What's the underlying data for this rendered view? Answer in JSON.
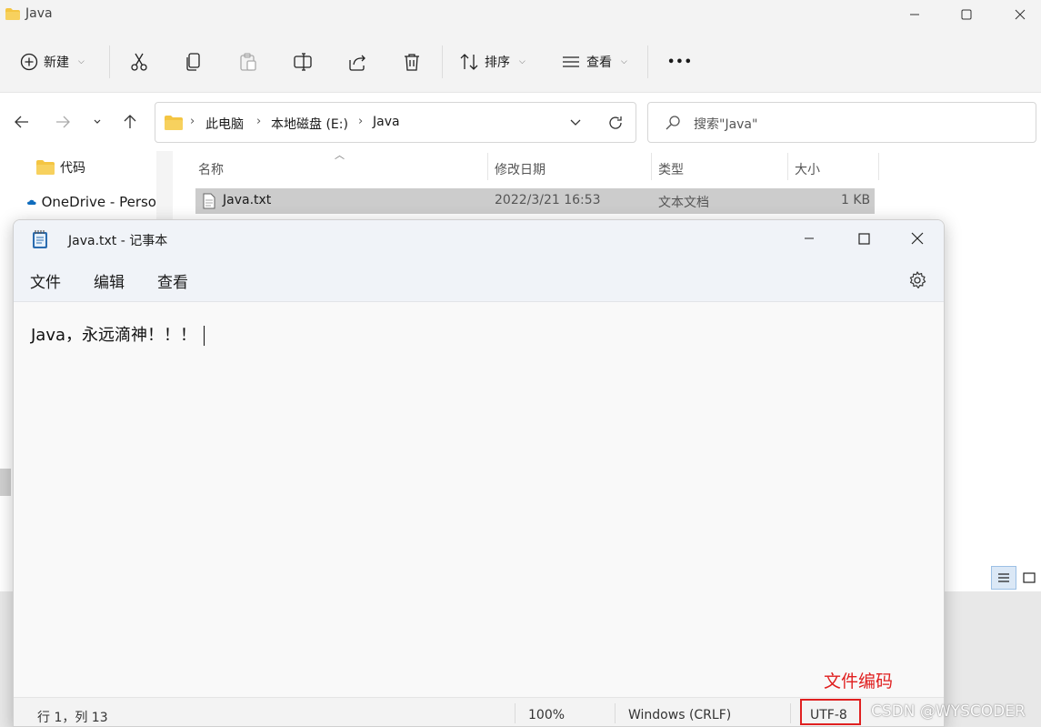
{
  "explorer": {
    "title": "Java",
    "toolbar": {
      "new_label": "新建",
      "sort_label": "排序",
      "view_label": "查看",
      "more_label": "•••"
    },
    "breadcrumb": [
      "此电脑",
      "本地磁盘 (E:)",
      "Java"
    ],
    "search_placeholder": "搜索\"Java\"",
    "nav_items": [
      {
        "label": "代码",
        "icon": "folder-icon"
      },
      {
        "label": "OneDrive - Perso",
        "icon": "onedrive-cloud-icon"
      }
    ],
    "columns": {
      "name": "名称",
      "modified": "修改日期",
      "type": "类型",
      "size": "大小"
    },
    "files": [
      {
        "name": "Java.txt",
        "modified": "2022/3/21 16:53",
        "type": "文本文档",
        "size": "1 KB"
      }
    ]
  },
  "notepad": {
    "title": "Java.txt - 记事本",
    "menus": [
      "文件",
      "编辑",
      "查看"
    ],
    "content": "Java，永远滴神！！！",
    "status": {
      "position": "行 1，列 13",
      "zoom": "100%",
      "line_ending": "Windows (CRLF)",
      "encoding": "UTF-8"
    }
  },
  "annotation": {
    "label": "文件编码",
    "color": "#e02020"
  },
  "watermark": "CSDN @WYSCODER",
  "colors": {
    "folder": "#f4c542",
    "onedrive": "#0f6cbd",
    "accent_highlight": "#e02020"
  }
}
